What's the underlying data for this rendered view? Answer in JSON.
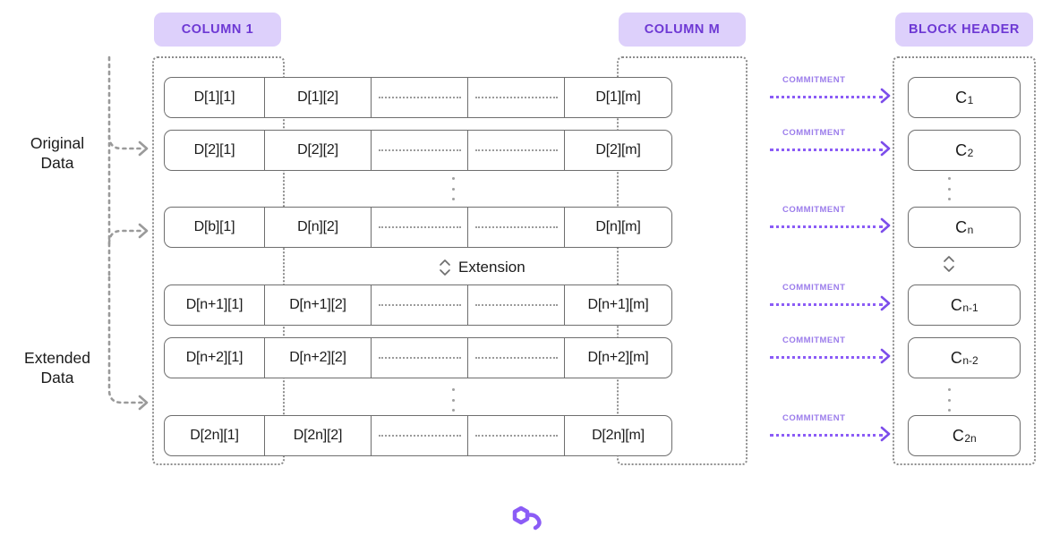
{
  "headers": {
    "column1": "COLUMN 1",
    "columnM": "COLUMN M",
    "blockHeader": "BLOCK HEADER"
  },
  "side_labels": {
    "original_line1": "Original",
    "original_line2": "Data",
    "extended_line1": "Extended",
    "extended_line2": "Data"
  },
  "extension": {
    "label": "Extension",
    "icon": "chevron-up-down-icon"
  },
  "commitment": {
    "label": "COMMITMENT",
    "arrow_icon": "arrow-right-icon"
  },
  "colors": {
    "accent_purple": "#8b5cf6",
    "pill_bg": "#ddd0fb",
    "pill_text": "#6d38d4",
    "commit_label": "#9b7ceb",
    "box_border": "#6e6e6e",
    "dotted_grey": "#8c8c8c",
    "background": "#ffffff"
  },
  "grid": {
    "rows": [
      {
        "id": "row-1",
        "c1": "D[1][1]",
        "c2": "D[1][2]",
        "cm": "D[1][m]"
      },
      {
        "id": "row-2",
        "c1": "D[2][1]",
        "c2": "D[2][2]",
        "cm": "D[2][m]"
      },
      {
        "id": "row-n",
        "c1": "D[b][1]",
        "c2": "D[n][2]",
        "cm": "D[n][m]"
      },
      {
        "id": "row-n1",
        "c1": "D[n+1][1]",
        "c2": "D[n+1][2]",
        "cm": "D[n+1][m]"
      },
      {
        "id": "row-n2",
        "c1": "D[n+2][1]",
        "c2": "D[n+2][2]",
        "cm": "D[n+2][m]"
      },
      {
        "id": "row-2n",
        "c1": "D[2n][1]",
        "c2": "D[2n][2]",
        "cm": "D[2n][m]"
      }
    ]
  },
  "block_header": {
    "boxes": [
      {
        "id": "c-1",
        "base": "C",
        "sub": "1"
      },
      {
        "id": "c-2",
        "base": "C",
        "sub": "2"
      },
      {
        "id": "c-n",
        "base": "C",
        "sub": "n"
      },
      {
        "id": "c-n-1",
        "base": "C",
        "sub": "n-1"
      },
      {
        "id": "c-n-2",
        "base": "C",
        "sub": "n-2"
      },
      {
        "id": "c-2n",
        "base": "C",
        "sub": "2n"
      }
    ]
  }
}
